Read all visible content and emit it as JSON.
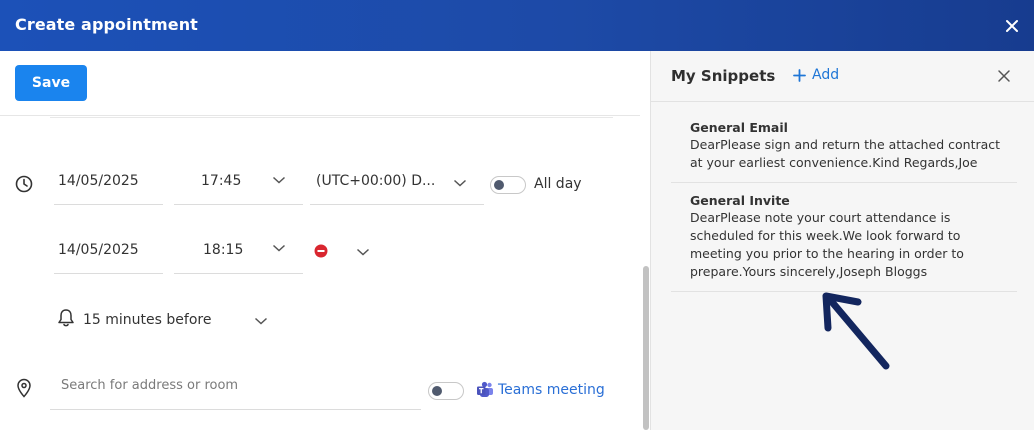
{
  "window": {
    "title": "Create appointment"
  },
  "toolbar": {
    "save_label": "Save"
  },
  "schedule": {
    "start_date": "14/05/2025",
    "start_time": "17:45",
    "timezone": "(UTC+00:00) D...",
    "all_day_label": "All day",
    "end_date": "14/05/2025",
    "end_time": "18:15"
  },
  "reminder": {
    "value": "15 minutes before"
  },
  "location": {
    "placeholder": "Search for address or room",
    "teams_label": "Teams meeting"
  },
  "snippets": {
    "title": "My Snippets",
    "add_label": "Add",
    "items": [
      {
        "name": "General Email",
        "lines": [
          "DearPlease sign and return the attached contract",
          "at your earliest convenience.Kind Regards,Joe"
        ]
      },
      {
        "name": "General Invite",
        "lines": [
          "DearPlease note your court attendance is",
          "scheduled for this week.We look forward to",
          "meeting you prior to the hearing in order to",
          "prepare.Yours sincerely,Joseph Bloggs"
        ]
      }
    ]
  },
  "colors": {
    "header": "#1d4aa7",
    "accent": "#1a84ee",
    "link": "#2a6fd6",
    "danger": "#d9262f",
    "annotation_arrow": "#13265e"
  },
  "icons": [
    "close-icon",
    "clock-icon",
    "chevron-down-icon",
    "bell-icon",
    "location-pin-icon",
    "teams-icon",
    "plus-icon",
    "remove-icon",
    "arrow-annotation"
  ]
}
